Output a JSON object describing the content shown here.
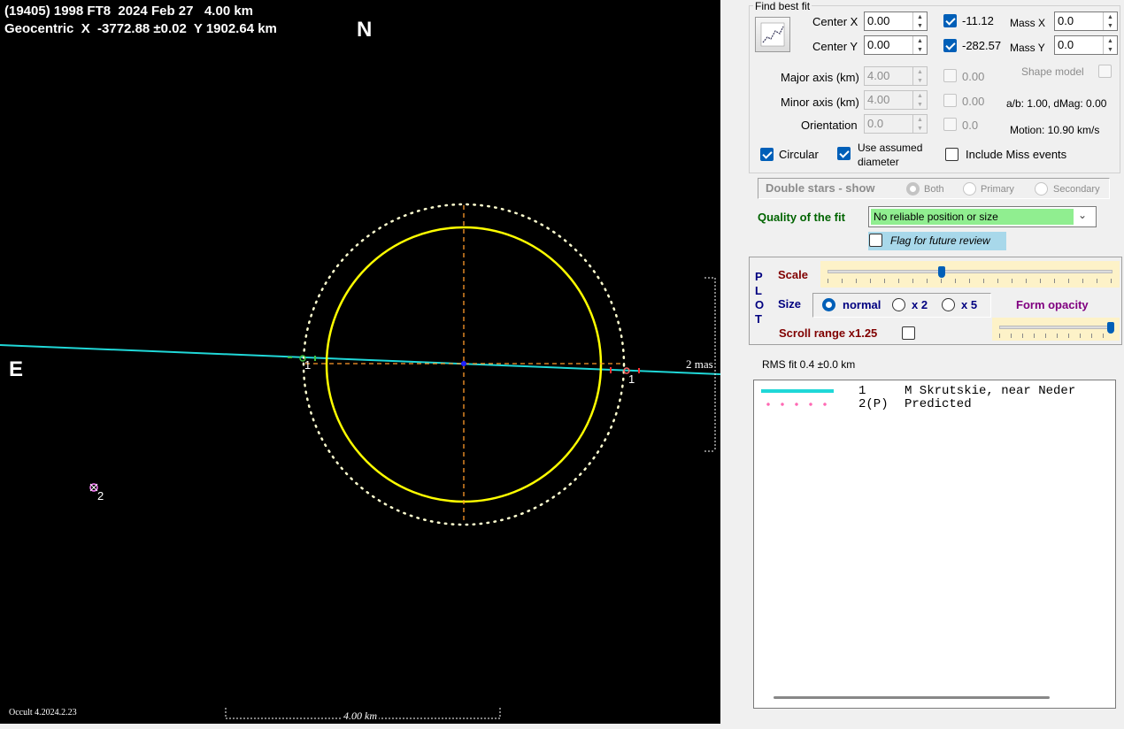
{
  "plot": {
    "title_line1": "(19405) 1998 FT8  2024 Feb 27   4.00 km",
    "title_line2": "Geocentric  X  -3772.88 ±0.02  Y 1902.64 km",
    "north": "N",
    "east": "E",
    "version": "Occult 4.2024.2.23",
    "scale_bar_label": "4.00 km",
    "mas_label": "2 mas",
    "chord_label_west": "1",
    "chord_label_east": "1",
    "predicted_label": "2"
  },
  "colors": {
    "chord": "#20d8d8",
    "ellipse": "#ffff00",
    "axes": "#ff9a2a",
    "quality_ok_bg": "#90ee90",
    "flag_bg": "#a8d8ea",
    "opacity_bg": "#fdf2c8",
    "plot_label": "#000080",
    "quality_label": "#006400",
    "form_opacity": "#800080"
  },
  "panel": {
    "find_best_fit": "Find best fit",
    "center_x_label": "Center X",
    "center_x_value": "0.00",
    "center_y_label": "Center Y",
    "center_y_value": "0.00",
    "fit_x_value": "-11.12",
    "fit_y_value": "-282.57",
    "mass_x_label": "Mass X",
    "mass_x_value": "0.0",
    "mass_y_label": "Mass Y",
    "mass_y_value": "0.0",
    "major_axis_label": "Major axis (km)",
    "major_axis_value": "4.00",
    "major_axis_fit": "0.00",
    "minor_axis_label": "Minor axis (km)",
    "minor_axis_value": "4.00",
    "minor_axis_fit": "0.00",
    "orientation_label": "Orientation",
    "orientation_value": "0.0",
    "orientation_fit": "0.0",
    "shape_model": "Shape model",
    "ab_dmag": "a/b: 1.00, dMag: 0.00",
    "motion": "Motion: 10.90 km/s",
    "circular": "Circular",
    "use_assumed_1": "Use assumed",
    "use_assumed_2": "diameter",
    "include_miss": "Include Miss events",
    "double_stars": "Double stars - show",
    "ds_both": "Both",
    "ds_primary": "Primary",
    "ds_secondary": "Secondary",
    "quality_label": "Quality of the fit",
    "quality_value": "No reliable position or size",
    "flag_review": "Flag for future review",
    "plot_vertical": [
      "P",
      "L",
      "O",
      "T"
    ],
    "scale_label": "Scale",
    "size_label": "Size",
    "size_normal": "normal",
    "size_x2": "x 2",
    "size_x5": "x 5",
    "form_opacity": "Form opacity",
    "scroll_range": "Scroll range x1.25",
    "rms_fit": "RMS fit 0.4 ±0.0 km",
    "scale_slider_level": 0.4,
    "opacity_slider_level": 1.0
  },
  "legend": [
    {
      "id": "1",
      "name": "M Skrutskie, near Neder",
      "style": "line"
    },
    {
      "id": "2(P)",
      "name": "Predicted",
      "style": "dots"
    }
  ]
}
